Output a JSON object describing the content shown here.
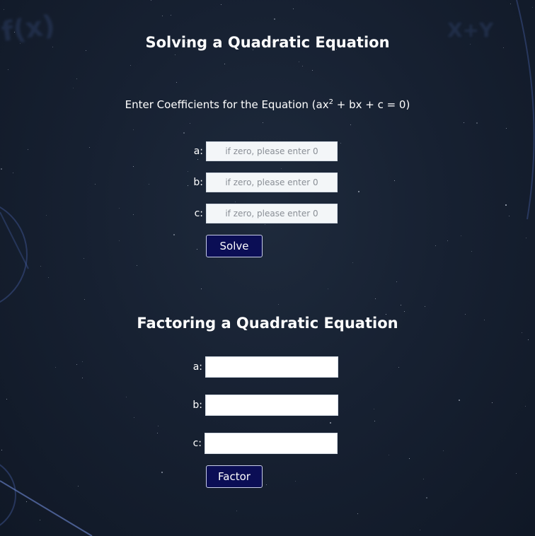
{
  "solve_section": {
    "title": "Solving a Quadratic Equation",
    "subtitle_prefix": "Enter Coefficients for the Equation (ax",
    "subtitle_exponent": "2",
    "subtitle_suffix": " + bx + c = 0)",
    "fields": [
      {
        "label": "a:",
        "placeholder": "if zero, please enter 0",
        "value": ""
      },
      {
        "label": "b:",
        "placeholder": "if zero, please enter 0",
        "value": ""
      },
      {
        "label": "c:",
        "placeholder": "if zero, please enter 0",
        "value": ""
      }
    ],
    "button_label": "Solve"
  },
  "factor_section": {
    "title": "Factoring a Quadratic Equation",
    "fields": [
      {
        "label": "a:",
        "value": ""
      },
      {
        "label": "b:",
        "value": ""
      },
      {
        "label": "c:",
        "value": ""
      }
    ],
    "button_label": "Factor"
  },
  "background": {
    "decor_glyph_left": "f(x)",
    "decor_glyph_right": "X+Y"
  },
  "colors": {
    "background": "#172132",
    "button": "#0b0e55",
    "text": "#ffffff"
  }
}
